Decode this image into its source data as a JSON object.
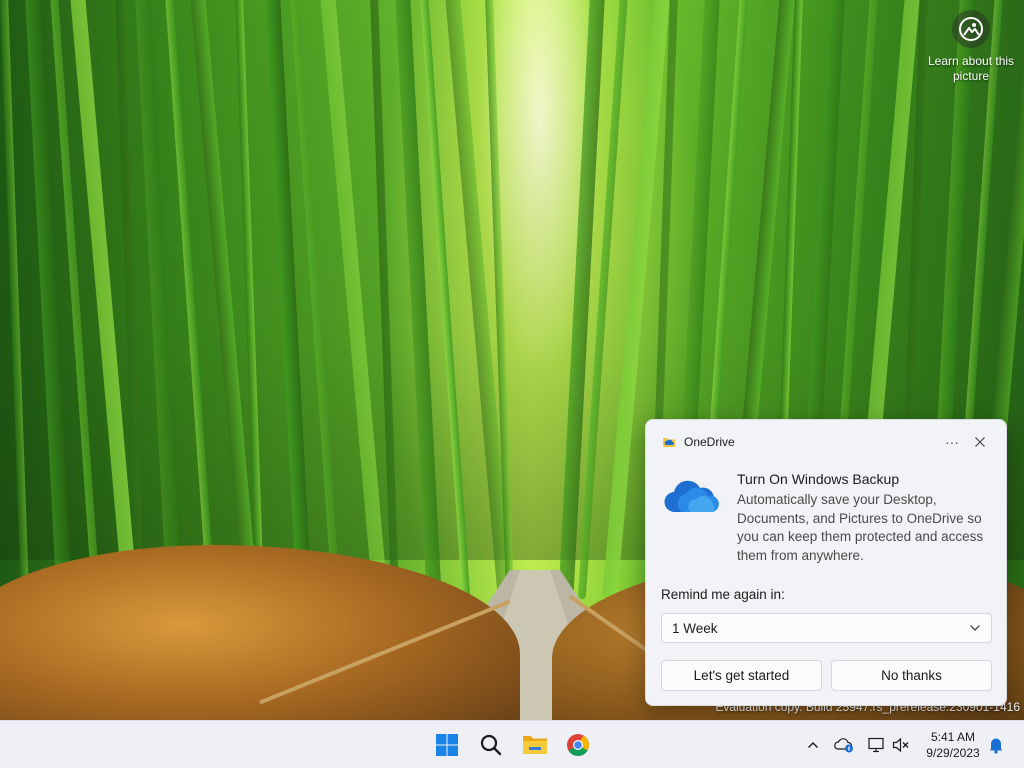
{
  "desktop": {
    "learn_about_picture": {
      "label": "Learn about this picture",
      "icon": "camera-pin-icon"
    },
    "watermark": "Evaluation copy. Build 25947.rs_prerelease.230901-1416"
  },
  "notification": {
    "app_name": "OneDrive",
    "app_icon": "onedrive-folder-icon",
    "more_label": "···",
    "close_icon": "close-icon",
    "title": "Turn On Windows Backup",
    "body": "Automatically save your Desktop, Documents, and Pictures to OneDrive so you can keep them protected and access them from anywhere.",
    "remind_label": "Remind me again in:",
    "remind_selected": "1 Week",
    "primary_button": "Let's get started",
    "secondary_button": "No thanks",
    "accent_color": "#0f6cbd"
  },
  "taskbar": {
    "pinned": [
      {
        "name": "start",
        "icon": "windows-logo-icon"
      },
      {
        "name": "search",
        "icon": "search-icon"
      },
      {
        "name": "file-explorer",
        "icon": "folder-icon"
      },
      {
        "name": "chrome",
        "icon": "chrome-icon"
      }
    ],
    "tray": {
      "overflow_icon": "chevron-up-icon",
      "onedrive_icon": "onedrive-cloud-icon",
      "network_icon": "network-icon",
      "volume_icon": "volume-muted-icon",
      "notification_icon": "bell-icon"
    },
    "clock": {
      "time": "5:41 AM",
      "date": "9/29/2023"
    }
  }
}
